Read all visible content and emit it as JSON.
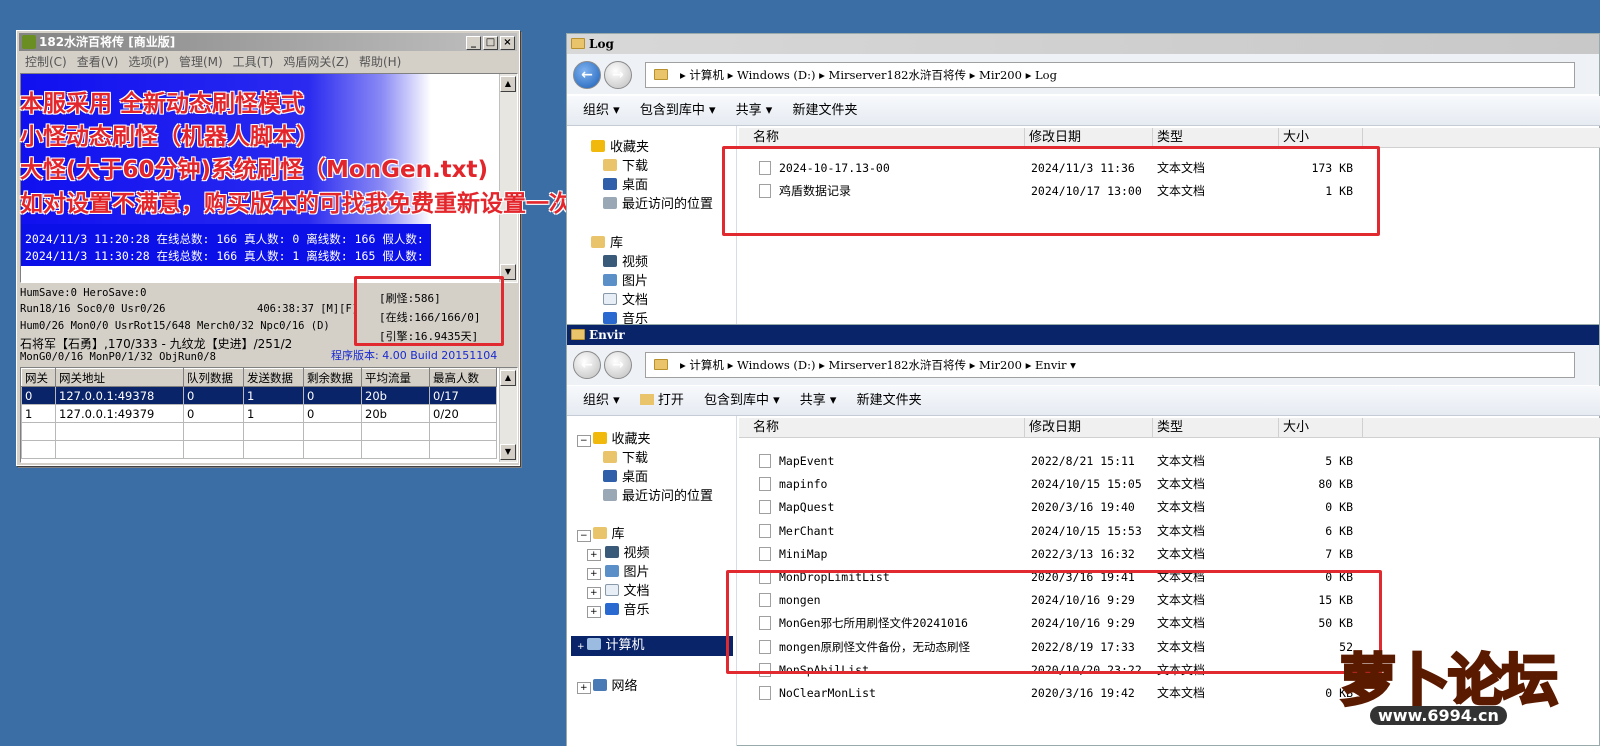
{
  "server_window": {
    "title": "182水浒百将传 [商业版]",
    "menu": [
      "控制(C)",
      "查看(V)",
      "选项(P)",
      "管理(M)",
      "工具(T)",
      "鸡盾网关(Z)",
      "帮助(H)"
    ],
    "log_lines": [
      "2024/11/3 11:20:28 在线总数: 166 真人数: 0 离线数: 166 假人数: 0",
      "2024/11/3 11:30:28 在线总数: 166 真人数: 1 离线数: 165 假人数: 0"
    ],
    "overlay_lines": [
      "本服采用 全新动态刷怪模式",
      "小怪动态刷怪（机器人脚本）",
      "大怪(大于60分钟)系统刷怪（MonGen.txt)",
      "如对设置不满意，购买版本的可找我免费重新设置一次"
    ],
    "stats": {
      "line1": "HumSave:0 HeroSave:0",
      "line2a": "Run18/16 Soc0/0 Usr0/26",
      "line2b": "406:38:37 [M][F]",
      "line3": "Hum0/26 Mon0/0 UsrRot15/648 Merch0/32 Npc0/16 (D)",
      "line4": "石将军【石勇】,170/333 - 九纹龙【史进】/251/2",
      "line5": "MonG0/0/16 MonP0/1/32 ObjRun0/8",
      "version": "程序版本: 4.00 Build 20151104",
      "box_refresh": "[刷怪:586]",
      "box_online": "[在线:166/166/0]",
      "box_engine": "[引擎:16.9435天]"
    },
    "gateway_table": {
      "headers": [
        "网关",
        "网关地址",
        "队列数据",
        "发送数据",
        "剩余数据",
        "平均流量",
        "最高人数"
      ],
      "rows": [
        [
          "0",
          "127.0.0.1:49378",
          "0",
          "1",
          "0",
          "20b",
          "0/17"
        ],
        [
          "1",
          "127.0.0.1:49379",
          "0",
          "1",
          "0",
          "20b",
          "0/20"
        ]
      ]
    }
  },
  "explorer_log": {
    "title": "Log",
    "address": "▸ 计算机 ▸ Windows (D:) ▸ Mirserver182水浒百将传 ▸ Mir200 ▸ Log",
    "toolbar": [
      "组织 ▾",
      "包含到库中 ▾",
      "共享 ▾",
      "新建文件夹"
    ],
    "nav": [
      "收藏夹",
      "下载",
      "桌面",
      "最近访问的位置",
      "库",
      "视频",
      "图片",
      "文档",
      "音乐"
    ],
    "columns": [
      "名称",
      "修改日期",
      "类型",
      "大小"
    ],
    "files": [
      {
        "name": "2024-10-17.13-00",
        "date": "2024/11/3 11:36",
        "type": "文本文档",
        "size": "173 KB"
      },
      {
        "name": "鸡盾数据记录",
        "date": "2024/10/17 13:00",
        "type": "文本文档",
        "size": "1 KB"
      }
    ]
  },
  "explorer_envir": {
    "title": "Envir",
    "address": "▸ 计算机 ▸ Windows (D:) ▸ Mirserver182水浒百将传 ▸ Mir200 ▸ Envir ▾",
    "toolbar": [
      "组织 ▾",
      "打开",
      "包含到库中 ▾",
      "共享 ▾",
      "新建文件夹"
    ],
    "nav": [
      "收藏夹",
      "下载",
      "桌面",
      "最近访问的位置",
      "库",
      "视频",
      "图片",
      "文档",
      "音乐",
      "计算机",
      "网络"
    ],
    "columns": [
      "名称",
      "修改日期",
      "类型",
      "大小"
    ],
    "files": [
      {
        "name": "MapEvent",
        "date": "2022/8/21 15:11",
        "type": "文本文档",
        "size": "5 KB"
      },
      {
        "name": "mapinfo",
        "date": "2024/10/15 15:05",
        "type": "文本文档",
        "size": "80 KB"
      },
      {
        "name": "MapQuest",
        "date": "2020/3/16 19:40",
        "type": "文本文档",
        "size": "0 KB"
      },
      {
        "name": "MerChant",
        "date": "2024/10/15 15:53",
        "type": "文本文档",
        "size": "6 KB"
      },
      {
        "name": "MiniMap",
        "date": "2022/3/13 16:32",
        "type": "文本文档",
        "size": "7 KB"
      },
      {
        "name": "MonDropLimitList",
        "date": "2020/3/16 19:41",
        "type": "文本文档",
        "size": "0 KB"
      },
      {
        "name": "mongen",
        "date": "2024/10/16 9:29",
        "type": "文本文档",
        "size": "15 KB"
      },
      {
        "name": "MonGen邪七所用刷怪文件20241016",
        "date": "2024/10/16 9:29",
        "type": "文本文档",
        "size": "50 KB"
      },
      {
        "name": "mongen原刷怪文件备份，无动态刷怪",
        "date": "2022/8/19 17:33",
        "type": "文本文档",
        "size": "52"
      },
      {
        "name": "MonSpAbilList",
        "date": "2020/10/20 23:22",
        "type": "文本文档",
        "size": "1"
      },
      {
        "name": "NoClearMonList",
        "date": "2020/3/16 19:42",
        "type": "文本文档",
        "size": "0 KB"
      }
    ]
  },
  "watermark": {
    "brand": "萝卜论坛",
    "url": "www.6994.cn"
  },
  "colors": {
    "desktop": "#3a6ea5",
    "highlight": "#e02a2f",
    "selection": "#0a246a"
  }
}
